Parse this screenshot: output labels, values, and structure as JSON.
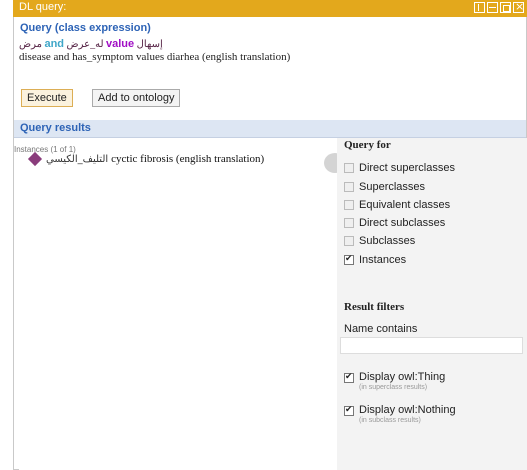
{
  "window": {
    "title": "DL query:"
  },
  "query": {
    "section_label": "Query (class expression)",
    "line1_arabic_a": "إسهال",
    "line1_value_kw": "value",
    "line1_arabic_b": "له_عرض",
    "line1_and_kw": "and",
    "line1_arabic_c": "مرض",
    "line2": "disease and has_symptom values diarhea (english translation)"
  },
  "buttons": {
    "execute": "Execute",
    "add": "Add to ontology"
  },
  "results": {
    "section_label": "Query results",
    "instances_header": "Instances (1 of 1)",
    "instance_arabic": "التليف_الكيسي",
    "instance_english": "cyctic fibrosis (english translation)"
  },
  "query_for": {
    "heading": "Query for",
    "options": [
      {
        "label": "Direct superclasses",
        "checked": false
      },
      {
        "label": "Superclasses",
        "checked": false
      },
      {
        "label": "Equivalent classes",
        "checked": false
      },
      {
        "label": "Direct subclasses",
        "checked": false
      },
      {
        "label": "Subclasses",
        "checked": false
      },
      {
        "label": "Instances",
        "checked": true
      }
    ]
  },
  "filters": {
    "heading": "Result filters",
    "name_label": "Name contains",
    "name_value": "",
    "thing_label": "Display owl:Thing",
    "thing_note": "(in superclass results)",
    "thing_checked": true,
    "nothing_label": "Display owl:Nothing",
    "nothing_note": "(in subclass results)",
    "nothing_checked": true
  },
  "colors": {
    "titlebar": "#e3a81c",
    "section_label": "#2d63b6",
    "keyword_and": "#3fa6c8",
    "keyword_value": "#a10fc5",
    "instance_icon": "#8a3c7c"
  }
}
